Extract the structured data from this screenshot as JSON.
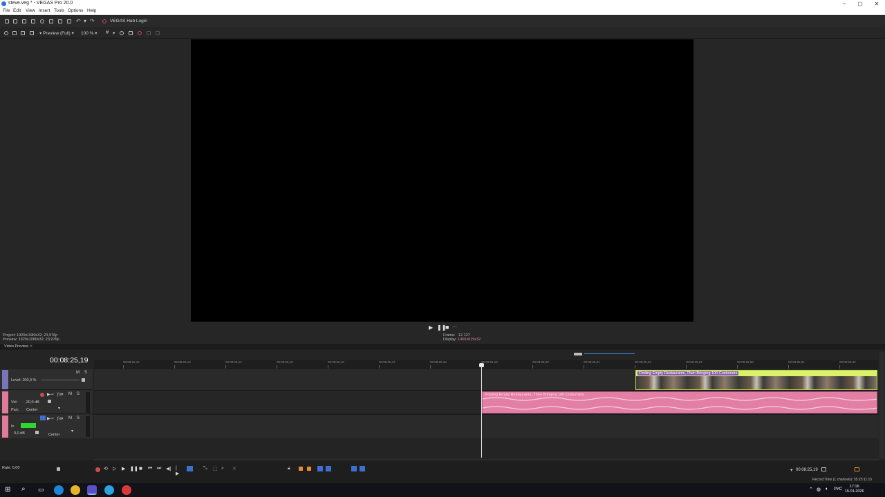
{
  "window": {
    "title": "steve.veg * - VEGAS Pro 20.0",
    "controls": [
      "–",
      "▢",
      "✕"
    ]
  },
  "menu": [
    "File",
    "Edit",
    "View",
    "Insert",
    "Tools",
    "Options",
    "Help"
  ],
  "toolbar": {
    "hub_label": "VEGAS Hub Login"
  },
  "preview_toolbar": {
    "quality": "Preview (Full)",
    "zoom": "100 %"
  },
  "preview": {
    "project_info": "Project:  1920x1080x32; 23,976p",
    "preview_info": "Preview:  1920x1080x32; 23,976p",
    "frame_label": "Frame:",
    "frame_value": "12 127",
    "display_label": "Display:",
    "display_value": "1456x819x32",
    "tab": "Video Preview"
  },
  "timeline": {
    "timecode": "00:08:25,19",
    "ruler_ticks": [
      "00:08:25,12",
      "00:08:25,13",
      "00:08:25,14",
      "00:08:25,15",
      "00:08:25,16",
      "00:08:25,17",
      "00:08:25,18",
      "00:08:25,19",
      "00:08:25,20",
      "00:08:25,21",
      "00:08:25,22",
      "00:08:25,23",
      "00:08:26,00",
      "00:08:26,01",
      "00:08:26,02"
    ],
    "video_track": {
      "level_label": "Level: 100,0 %",
      "m": "M",
      "s": "S"
    },
    "audio_track": {
      "vol_label": "Vol:",
      "vol_value": "-20,0 dB",
      "pan_label": "Pan:",
      "pan_value": "Center",
      "m": "M",
      "s": "S"
    },
    "input_track": {
      "in_label": "In",
      "level": "0,0 dB",
      "pan_value": "Center",
      "m": "M",
      "s": "S"
    },
    "video_clip_title": "Finding Empty Restaurants, Then Bringing 100 Customers",
    "audio_clip_title": "Finding Empty Restaurants, Then Bringing 100 Customers"
  },
  "bottom": {
    "rate": "Rate: 0,00",
    "cursor_time": "00:08:25,19",
    "record_time": "Record Time (1 channels): 55:23:11:15"
  },
  "taskbar": {
    "language": "РУС",
    "time": "17:16",
    "date": "15.01.2026"
  },
  "colors": {
    "video_clip": "#d9f26a",
    "audio_clip": "#e37fa4",
    "clip_title_bg": "#8a5bbd",
    "video_track_header": "#7a74b8",
    "audio_track_header": "#e07a9a"
  }
}
